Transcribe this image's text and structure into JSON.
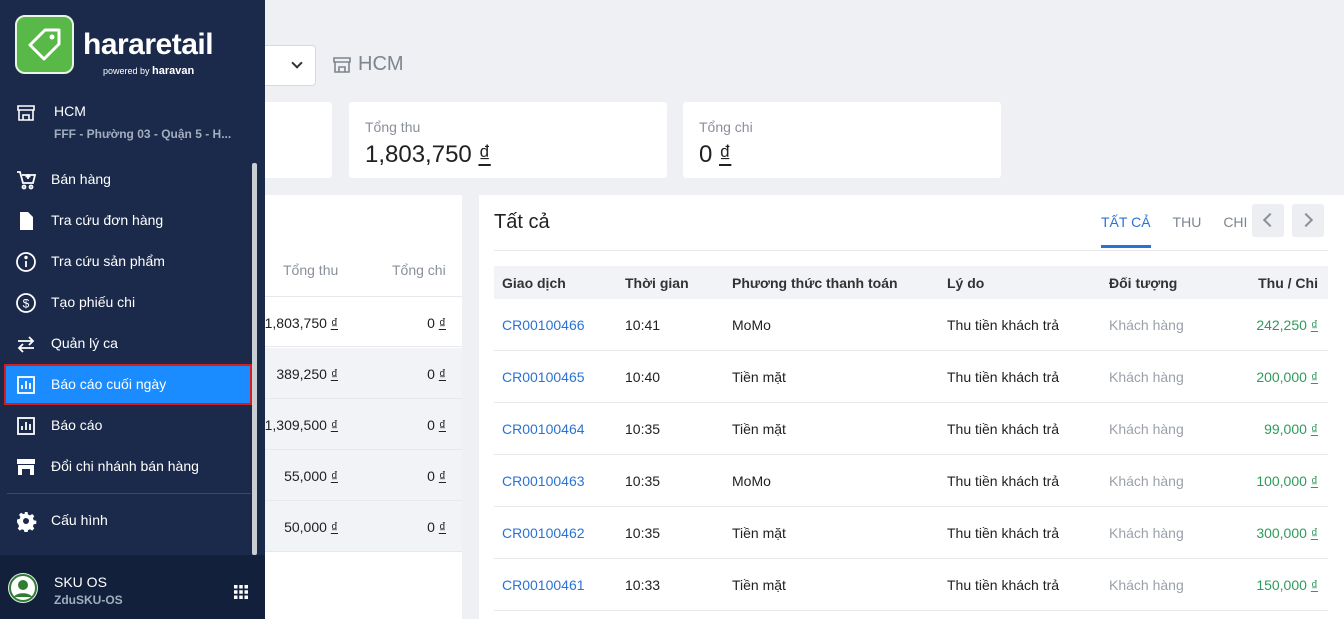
{
  "colors": {
    "sidebar": "#1b2a4a",
    "accent": "#1a8cff",
    "link": "#2a73d4",
    "income": "#2e9b5c",
    "highlight_border": "#d0201f"
  },
  "header": {
    "store_label": "HCM"
  },
  "stats": [
    {
      "label": "",
      "value": ""
    },
    {
      "label": "Tổng thu",
      "value": "1,803,750",
      "currency": "₫"
    },
    {
      "label": "Tổng chi",
      "value": "0",
      "currency": "₫"
    }
  ],
  "left_table": {
    "col_thu": "Tổng thu",
    "col_chi": "Tổng chi",
    "rows": [
      {
        "thu": "1,803,750",
        "chi": "0"
      },
      {
        "thu": "389,250",
        "chi": "0"
      },
      {
        "thu": "1,309,500",
        "chi": "0"
      },
      {
        "thu": "55,000",
        "chi": "0"
      },
      {
        "thu": "50,000",
        "chi": "0"
      }
    ],
    "currency": "₫"
  },
  "transactions": {
    "title": "Tất cả",
    "tabs": [
      {
        "label": "TẤT CẢ",
        "active": true
      },
      {
        "label": "THU"
      },
      {
        "label": "CHI"
      }
    ],
    "columns": {
      "id": "Giao dịch",
      "time": "Thời gian",
      "payment": "Phương thức thanh toán",
      "reason": "Lý do",
      "object": "Đối tượng",
      "amount": "Thu / Chi"
    },
    "rows": [
      {
        "id": "CR00100466",
        "time": "10:41",
        "payment": "MoMo",
        "reason": "Thu tiền khách trả",
        "object": "Khách hàng",
        "amount": "242,250"
      },
      {
        "id": "CR00100465",
        "time": "10:40",
        "payment": "Tiền mặt",
        "reason": "Thu tiền khách trả",
        "object": "Khách hàng",
        "amount": "200,000"
      },
      {
        "id": "CR00100464",
        "time": "10:35",
        "payment": "Tiền mặt",
        "reason": "Thu tiền khách trả",
        "object": "Khách hàng",
        "amount": "99,000"
      },
      {
        "id": "CR00100463",
        "time": "10:35",
        "payment": "MoMo",
        "reason": "Thu tiền khách trả",
        "object": "Khách hàng",
        "amount": "100,000"
      },
      {
        "id": "CR00100462",
        "time": "10:35",
        "payment": "Tiền mặt",
        "reason": "Thu tiền khách trả",
        "object": "Khách hàng",
        "amount": "300,000"
      },
      {
        "id": "CR00100461",
        "time": "10:33",
        "payment": "Tiền mặt",
        "reason": "Thu tiền khách trả",
        "object": "Khách hàng",
        "amount": "150,000"
      }
    ],
    "currency": "₫"
  },
  "sidebar": {
    "brand": "hararetail",
    "powered_by": "powered by",
    "powered_brand": "haravan",
    "branch": {
      "name": "HCM",
      "address": "FFF - Phường 03 - Quận 5 - H..."
    },
    "items": [
      {
        "label": "Bán hàng",
        "icon": "cart-icon"
      },
      {
        "label": "Tra cứu đơn hàng",
        "icon": "document-icon"
      },
      {
        "label": "Tra cứu sản phẩm",
        "icon": "info-icon"
      },
      {
        "label": "Tạo phiếu chi",
        "icon": "dollar-icon"
      },
      {
        "label": "Quản lý ca",
        "icon": "swap-icon"
      },
      {
        "label": "Báo cáo cuối ngày",
        "icon": "report-icon",
        "active": true
      },
      {
        "label": "Báo cáo",
        "icon": "report-icon"
      },
      {
        "label": "Đổi chi nhánh bán hàng",
        "icon": "store-icon"
      },
      {
        "label": "Cấu hình",
        "icon": "gear-icon"
      }
    ],
    "user": {
      "name": "SKU OS",
      "sub": "ZduSKU-OS"
    }
  }
}
